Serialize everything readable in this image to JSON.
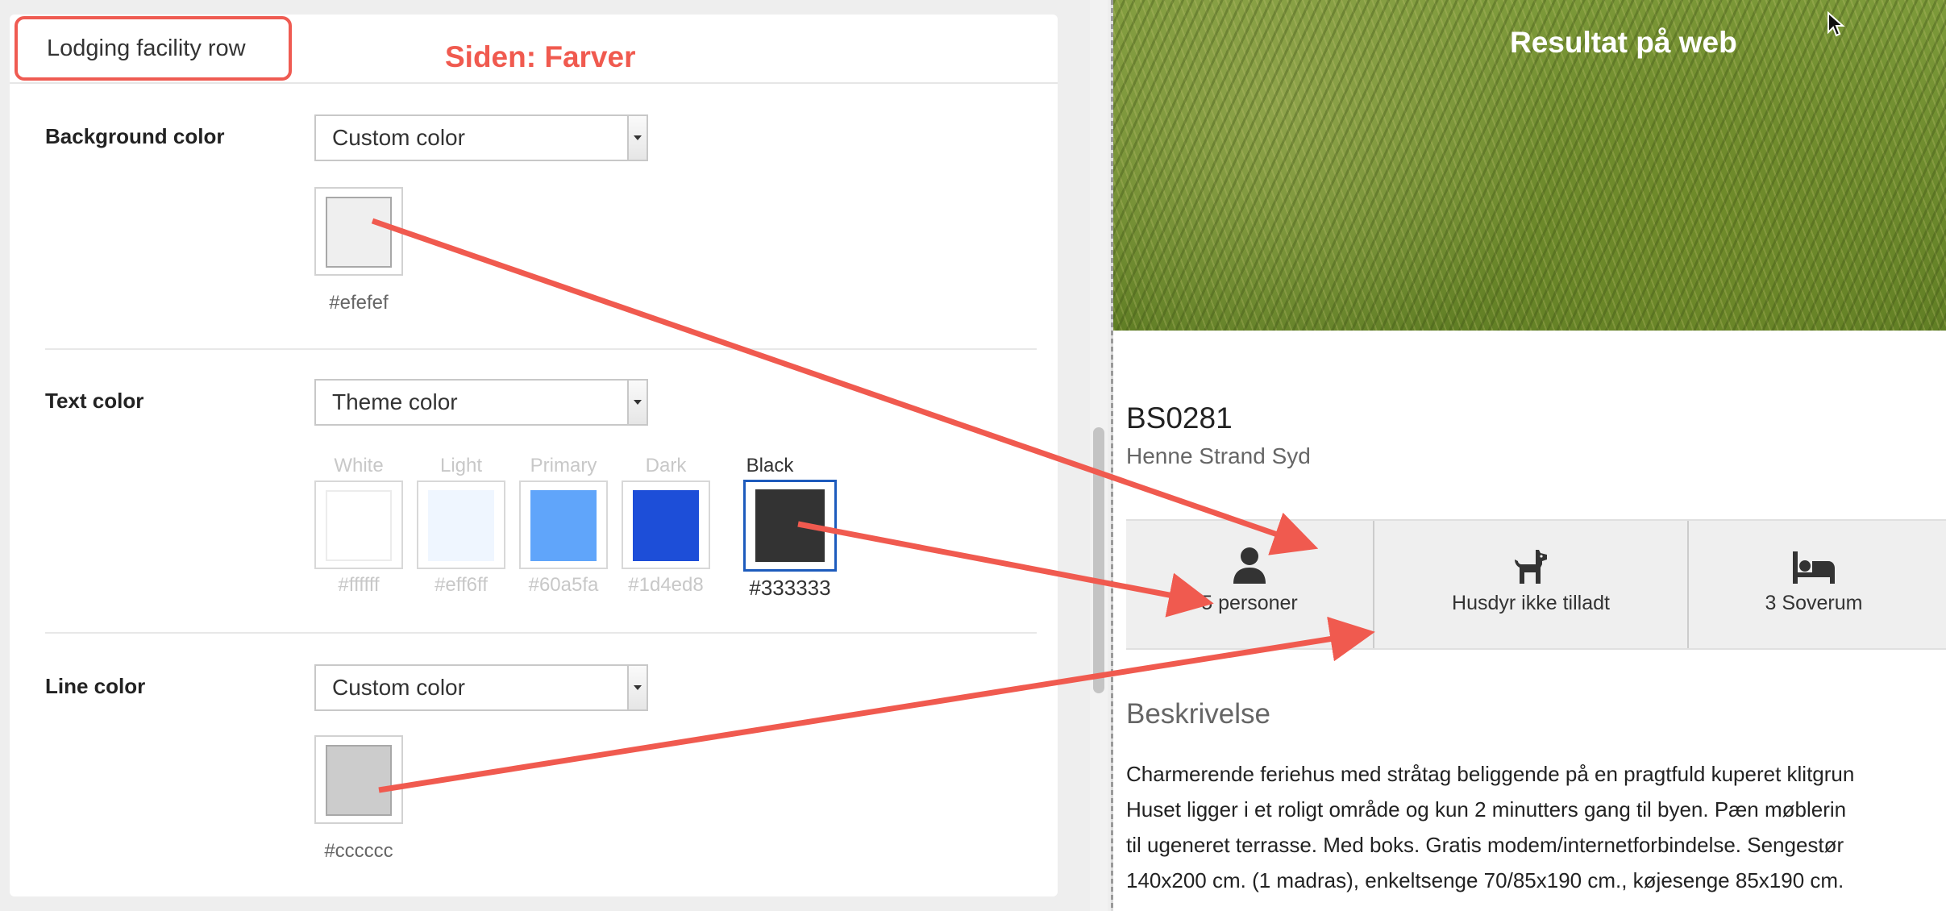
{
  "panel": {
    "title": "Lodging facility row",
    "annotation": "Siden: Farver"
  },
  "settings": {
    "background": {
      "label": "Background color",
      "select_value": "Custom color",
      "swatch_color": "#efefef",
      "hex": "#efefef"
    },
    "text": {
      "label": "Text color",
      "select_value": "Theme color",
      "swatches": [
        {
          "name": "White",
          "color": "#ffffff",
          "hex": "#ffffff"
        },
        {
          "name": "Light",
          "color": "#eff6ff",
          "hex": "#eff6ff"
        },
        {
          "name": "Primary",
          "color": "#60a5fa",
          "hex": "#60a5fa"
        },
        {
          "name": "Dark",
          "color": "#1d4ed8",
          "hex": "#1d4ed8"
        },
        {
          "name": "Black",
          "color": "#333333",
          "hex": "#333333"
        }
      ],
      "selected": "Black"
    },
    "line": {
      "label": "Line color",
      "select_value": "Custom color",
      "swatch_color": "#cccccc",
      "hex": "#cccccc"
    }
  },
  "preview": {
    "annotation": "Resultat på web",
    "property_code": "BS0281",
    "area": "Henne Strand Syd",
    "facilities": [
      {
        "icon": "person-icon",
        "label": "5 personer"
      },
      {
        "icon": "dog-icon",
        "label": "Husdyr ikke tilladt"
      },
      {
        "icon": "bed-icon",
        "label": "3 Soverum"
      }
    ],
    "description_heading": "Beskrivelse",
    "description_lines": [
      "Charmerende feriehus med stråtag beliggende på en pragtfuld kuperet klitgrun",
      "Huset ligger i et roligt område og kun 2 minutters gang til byen. Pæn møblerin",
      "til ugeneret terrasse. Med boks. Gratis modem/internetforbindelse. Sengestør",
      "140x200 cm. (1 madras), enkeltsenge 70/85x190 cm., køjesenge 85x190 cm."
    ]
  },
  "colors": {
    "annotation_red": "#f05a4f",
    "facility_bg": "#efefef",
    "facility_line": "#cccccc",
    "selected_border": "#1d5bbd"
  }
}
